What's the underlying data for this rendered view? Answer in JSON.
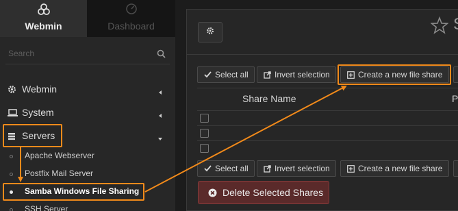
{
  "sidebar": {
    "tabs": [
      {
        "label": "Webmin",
        "icon": "webmin-logo-icon"
      },
      {
        "label": "Dashboard",
        "icon": "dashboard-gauge-icon"
      }
    ],
    "search_placeholder": "Search",
    "items": [
      {
        "label": "Webmin",
        "icon": "gear-icon"
      },
      {
        "label": "System",
        "icon": "laptop-icon"
      },
      {
        "label": "Servers",
        "icon": "server-icon"
      }
    ],
    "sub_items": [
      {
        "label": "Apache Webserver"
      },
      {
        "label": "Postfix Mail Server"
      },
      {
        "label": "Samba Windows File Sharing"
      },
      {
        "label": "SSH Server"
      }
    ]
  },
  "main": {
    "title_fragment": "S",
    "toolbar_top": {
      "select_all": "Select all",
      "invert_selection": "Invert selection",
      "create_share": "Create a new file share"
    },
    "table": {
      "columns": [
        "Share Name",
        "P"
      ],
      "row_count_visible": 3
    },
    "toolbar_bottom": {
      "select_all": "Select all",
      "invert_selection": "Invert selection",
      "create_share": "Create a new file share"
    },
    "delete_button": "Delete Selected Shares"
  },
  "colors": {
    "highlight": "#f28a1a",
    "danger": "#5a2a2a",
    "sidebar_bg": "#272727"
  }
}
